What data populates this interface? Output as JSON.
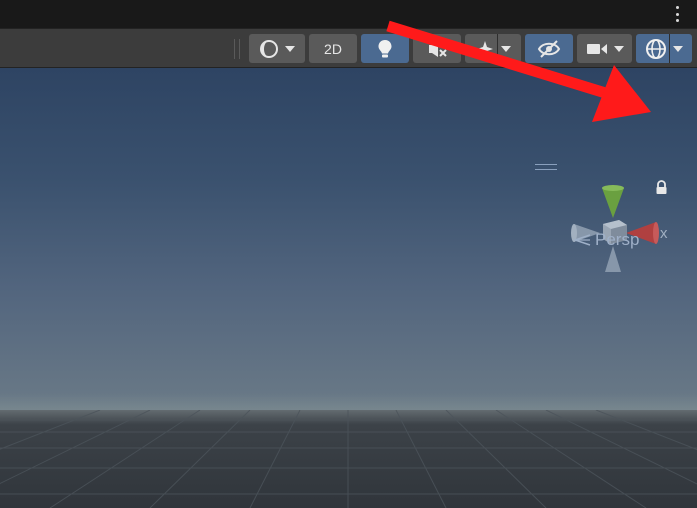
{
  "toolbar": {
    "btn_2d": "2D"
  },
  "gizmo": {
    "projection_label": "Persp",
    "axis_x_label": "x",
    "axis_x_color": "#b04040",
    "axis_y_color": "#6aa040"
  },
  "annotation": {
    "arrow_color": "#ff1a1a",
    "points_to": "lock-icon"
  },
  "icons": [
    "kebab-menu-icon",
    "shading-mode-icon",
    "lighting-icon",
    "audio-mute-icon",
    "effects-icon",
    "visibility-icon",
    "camera-icon",
    "gizmos-icon",
    "lock-icon"
  ]
}
